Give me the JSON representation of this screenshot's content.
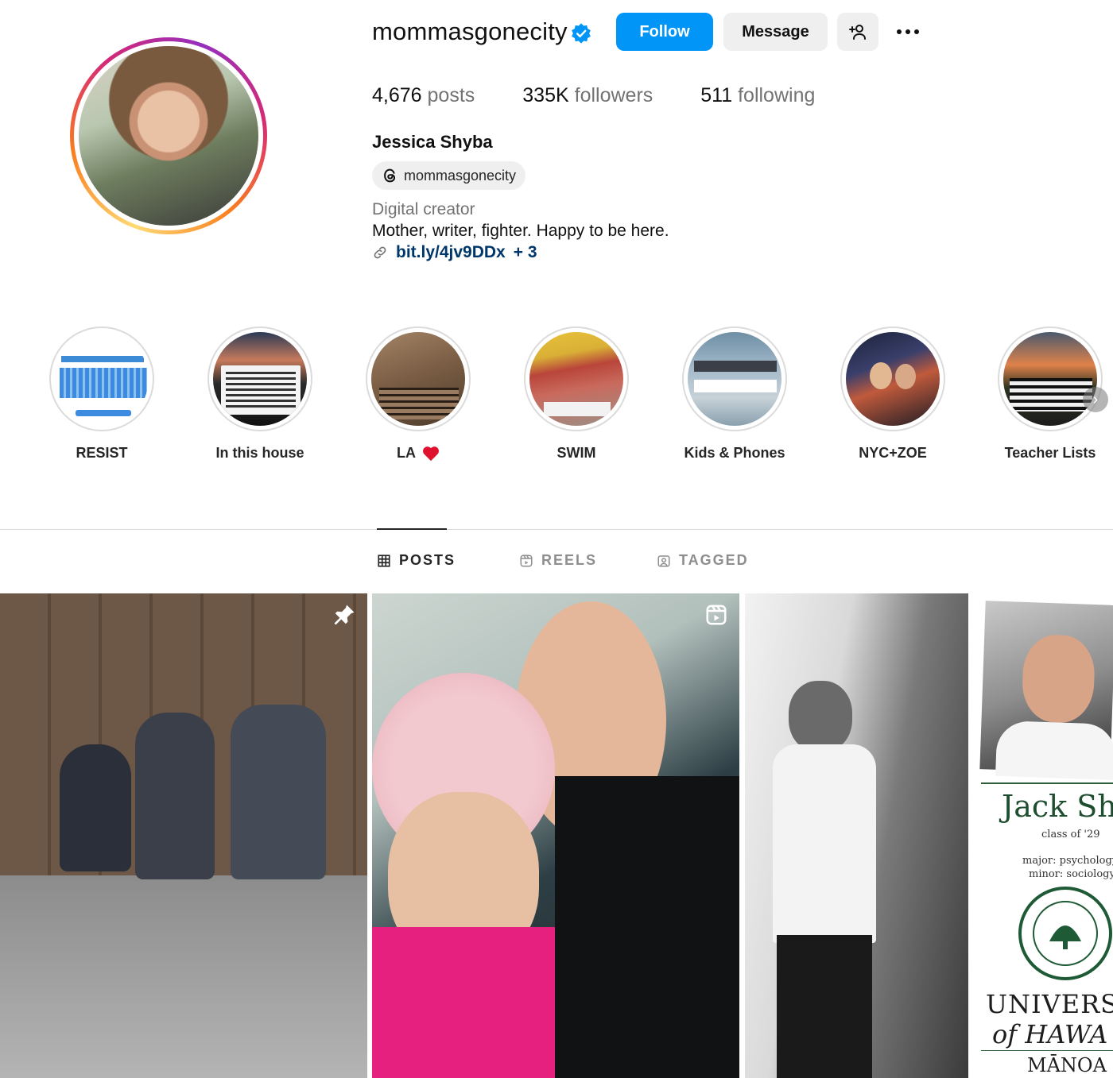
{
  "profile": {
    "username": "mommasgonecity",
    "full_name": "Jessica Shyba",
    "threads_handle": "mommasgonecity",
    "category": "Digital creator",
    "bio": "Mother, writer, fighter. Happy to be here.",
    "link": "bit.ly/4jv9DDx",
    "link_more": "+ 3",
    "verified": true
  },
  "actions": {
    "follow": "Follow",
    "message": "Message"
  },
  "stats": {
    "posts_count": "4,676",
    "posts_label": "posts",
    "followers_count": "335K",
    "followers_label": "followers",
    "following_count": "511",
    "following_label": "following"
  },
  "highlights": [
    {
      "label": "RESIST"
    },
    {
      "label": "In this house"
    },
    {
      "label": "LA"
    },
    {
      "label": "SWIM"
    },
    {
      "label": "Kids & Phones"
    },
    {
      "label": "NYC+ZOE"
    },
    {
      "label": "Teacher Lists"
    }
  ],
  "tabs": {
    "posts": "POSTS",
    "reels": "REELS",
    "tagged": "TAGGED"
  },
  "posts": [
    {
      "badge": "pin-icon"
    },
    {
      "badge": "reel-icon"
    },
    {
      "badge": ""
    },
    {
      "caption_name": "Jack Shy",
      "caption_class": "class of '29",
      "caption_major": "major: psychology",
      "caption_minor": "minor: sociology",
      "caption_univ1": "UNIVERSI",
      "caption_univ2": "of HAWA",
      "caption_univ3": "MĀNOA"
    }
  ],
  "colors": {
    "accent": "#0095f6",
    "link": "#00376b",
    "verified": "#0095f6"
  }
}
